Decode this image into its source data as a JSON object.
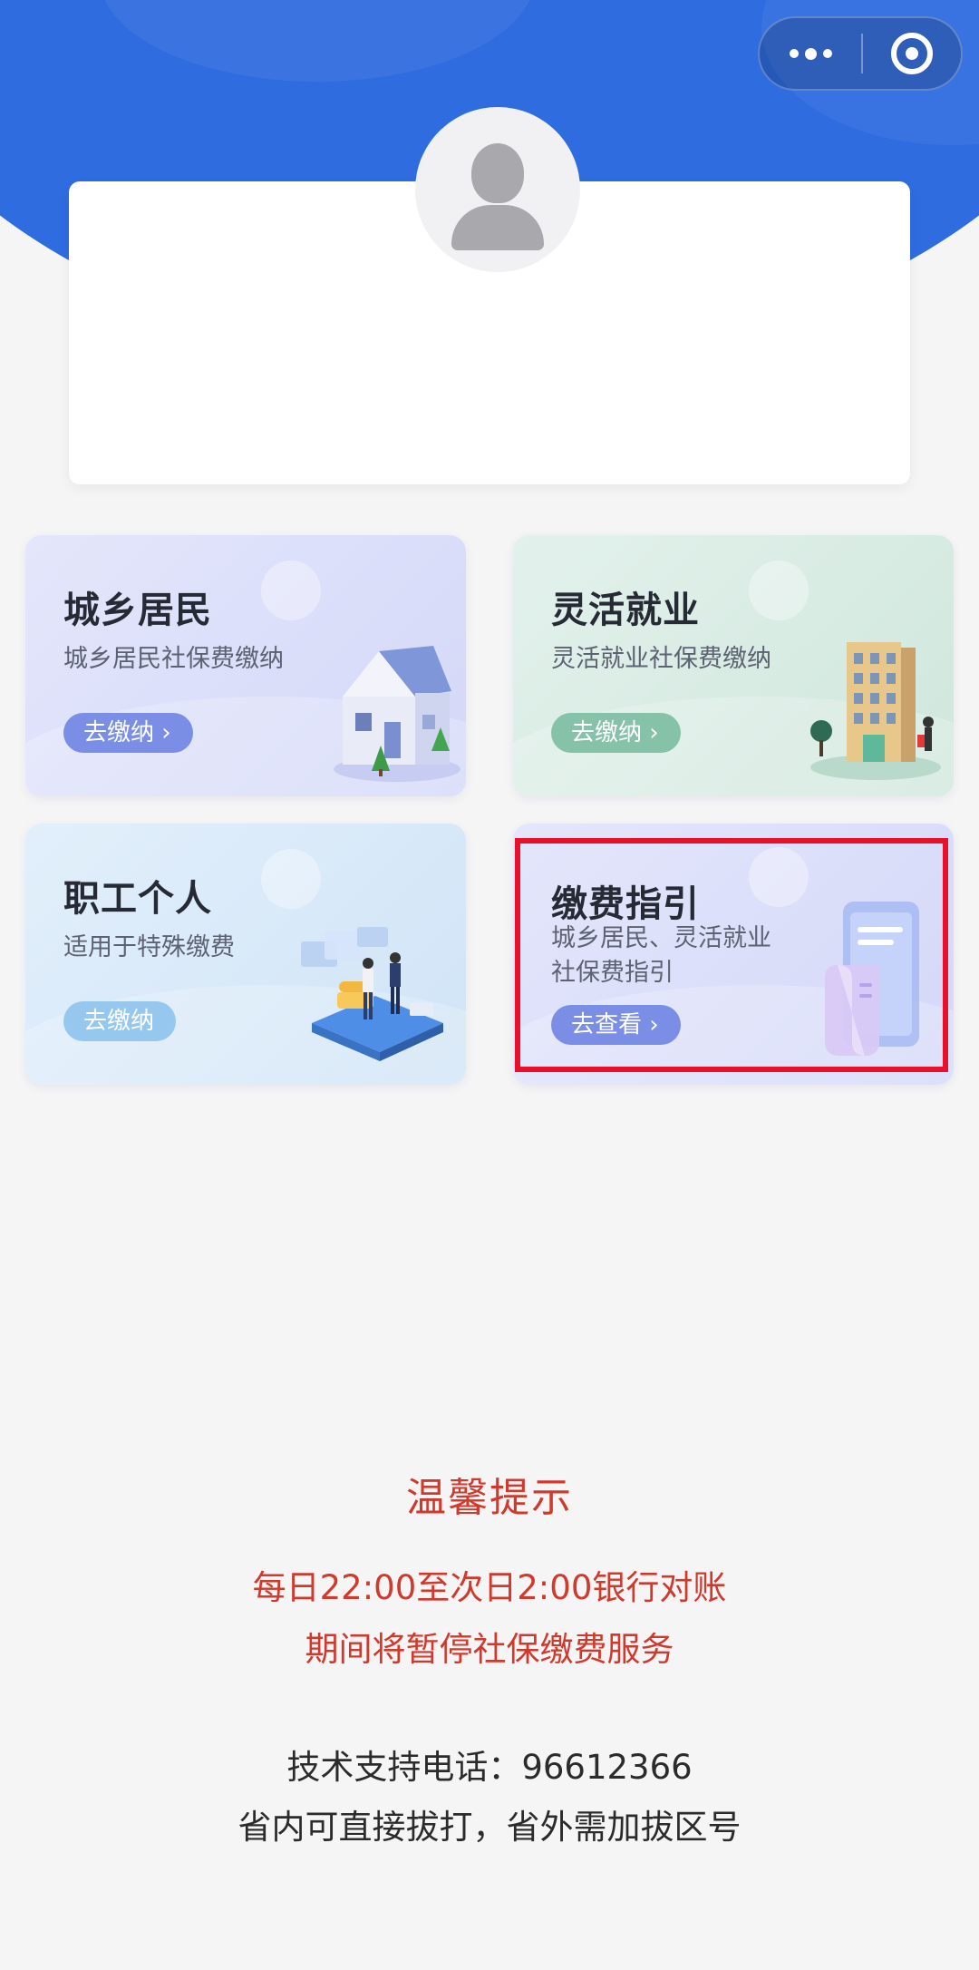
{
  "capsule": {
    "more_icon": "more-dots-icon",
    "close_icon": "target-close-icon"
  },
  "user": {
    "avatar_icon": "default-user-icon"
  },
  "services": [
    {
      "title": "城乡居民",
      "subtitle": "城乡居民社保费缴纳",
      "button": "去缴纳",
      "illustration": "house-icon"
    },
    {
      "title": "灵活就业",
      "subtitle": "灵活就业社保费缴纳",
      "button": "去缴纳",
      "illustration": "building-icon"
    },
    {
      "title": "职工个人",
      "subtitle": "适用于特殊缴费",
      "button": "去缴纳",
      "illustration": "office-workers-icon"
    },
    {
      "title": "缴费指引",
      "subtitle_line1": "城乡居民、灵活就业",
      "subtitle_line2": "社保费指引",
      "button": "去查看",
      "illustration": "phone-receipt-icon"
    }
  ],
  "notice": {
    "title": "温馨提示",
    "line1": "每日22:00至次日2:00银行对账",
    "line2": "期间将暂停社保缴费服务"
  },
  "support": {
    "phone_line": "技术支持电话：96612366",
    "dial_note": "省内可直接拔打，省外需加拔区号"
  },
  "colors": {
    "header_blue": "#2f6ce0",
    "highlight_red": "#e8102a",
    "notice_red": "#d1392c"
  }
}
